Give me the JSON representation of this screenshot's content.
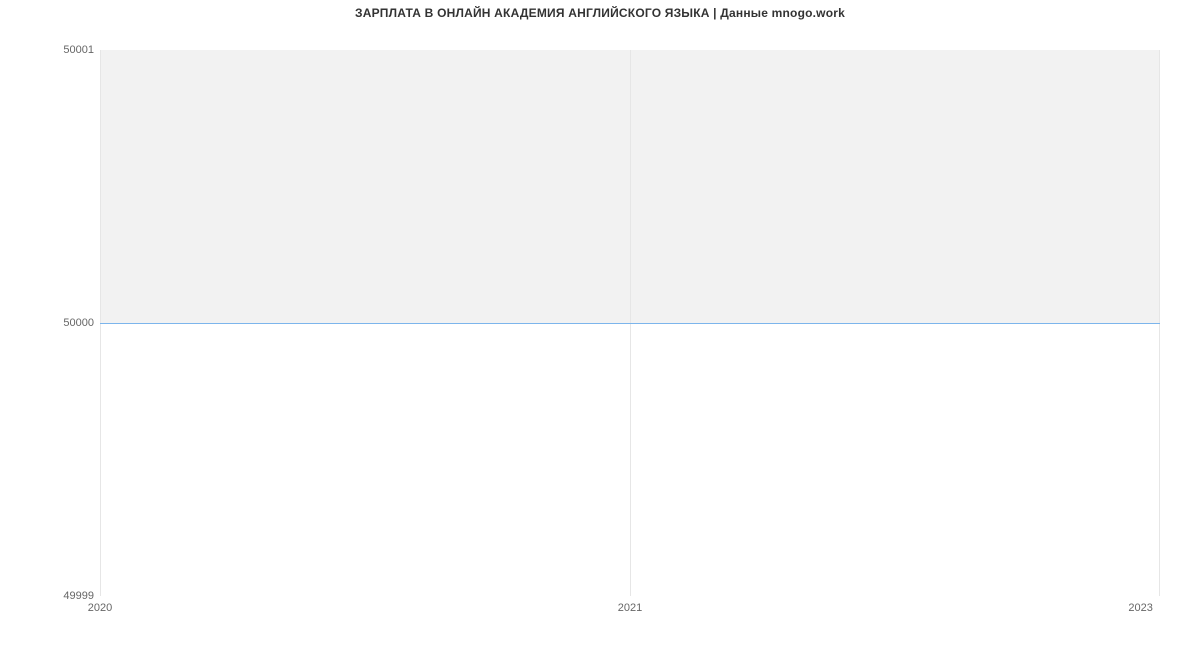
{
  "chart_data": {
    "type": "line",
    "title": "ЗАРПЛАТА В ОНЛАЙН АКАДЕМИЯ АНГЛИЙСКОГО ЯЗЫКА | Данные mnogo.work",
    "x": [
      2020,
      2021,
      2023
    ],
    "values": [
      50000,
      50000,
      50000
    ],
    "x_ticks": [
      "2020",
      "2021",
      "2023"
    ],
    "y_ticks": [
      "49999",
      "50000",
      "50001"
    ],
    "xlim": [
      2020,
      2023
    ],
    "ylim": [
      49999,
      50001
    ],
    "xlabel": "",
    "ylabel": "",
    "line_color": "#7cb5ec"
  }
}
